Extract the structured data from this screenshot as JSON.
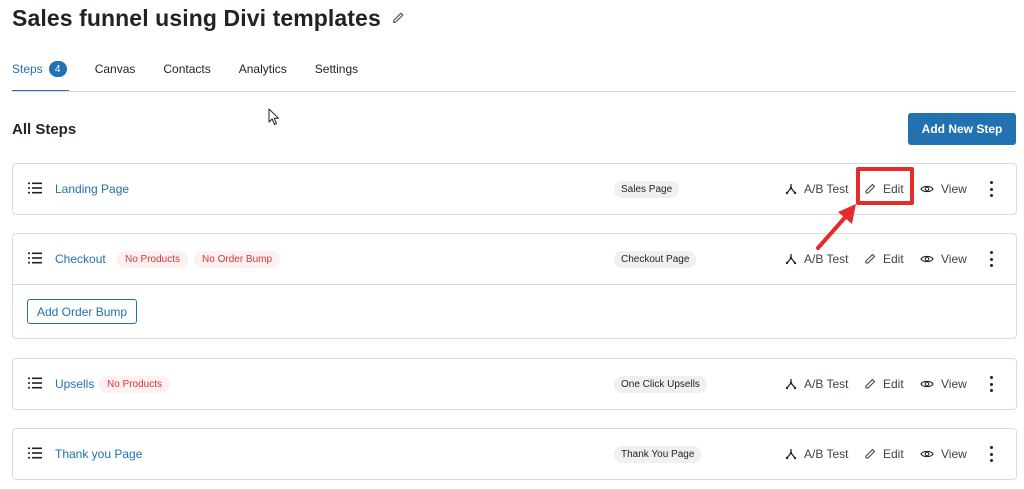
{
  "page": {
    "title": "Sales funnel using Divi templates",
    "title_edit_icon": "pencil-icon"
  },
  "tabs": [
    {
      "label": "Steps",
      "badge": "4",
      "active": true
    },
    {
      "label": "Canvas"
    },
    {
      "label": "Contacts"
    },
    {
      "label": "Analytics"
    },
    {
      "label": "Settings"
    }
  ],
  "section": {
    "title": "All Steps",
    "add_button": "Add New Step"
  },
  "actions": {
    "ab_test": "A/B Test",
    "edit": "Edit",
    "view": "View"
  },
  "steps": [
    {
      "name": "Landing Page",
      "tags": [],
      "type": "Sales Page"
    },
    {
      "name": "Checkout",
      "tags": [
        "No Products",
        "No Order Bump"
      ],
      "type": "Checkout Page",
      "extra_button": "Add Order Bump"
    },
    {
      "name": "Upsells",
      "tags": [
        "No Products"
      ],
      "type": "One Click Upsells"
    },
    {
      "name": "Thank you Page",
      "tags": [],
      "type": "Thank You Page"
    }
  ],
  "colors": {
    "accent": "#2271b1",
    "highlight": "#e52b2b",
    "warning_text": "#d63638",
    "warning_bg": "#fcf0f1"
  }
}
